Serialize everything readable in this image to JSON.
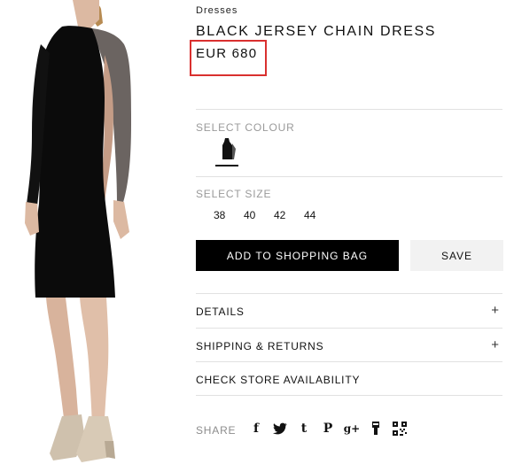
{
  "product": {
    "category": "Dresses",
    "title": "BLACK JERSEY CHAIN DRESS",
    "price": "EUR 680",
    "image_alt": "model-wearing-black-dress",
    "highlight_color": "#d9302f"
  },
  "colour": {
    "label": "SELECT COLOUR",
    "selected": "black"
  },
  "size": {
    "label": "SELECT SIZE",
    "options": [
      "38",
      "40",
      "42",
      "44"
    ]
  },
  "actions": {
    "add_to_bag": "ADD TO SHOPPING BAG",
    "save": "SAVE"
  },
  "accordion": {
    "details": "DETAILS",
    "details_icon": "+",
    "shipping": "SHIPPING & RETURNS",
    "shipping_icon": "+",
    "store": "CHECK STORE AVAILABILITY"
  },
  "share": {
    "label": "SHARE",
    "icons": [
      {
        "name": "facebook-icon",
        "glyph": "f"
      },
      {
        "name": "twitter-icon",
        "glyph": "🐦"
      },
      {
        "name": "tumblr-icon",
        "glyph": "t"
      },
      {
        "name": "pinterest-icon",
        "glyph": "P"
      },
      {
        "name": "google-plus-icon",
        "glyph": "g+"
      },
      {
        "name": "weibo-icon",
        "glyph": ""
      },
      {
        "name": "qr-code-icon",
        "glyph": ""
      }
    ]
  }
}
